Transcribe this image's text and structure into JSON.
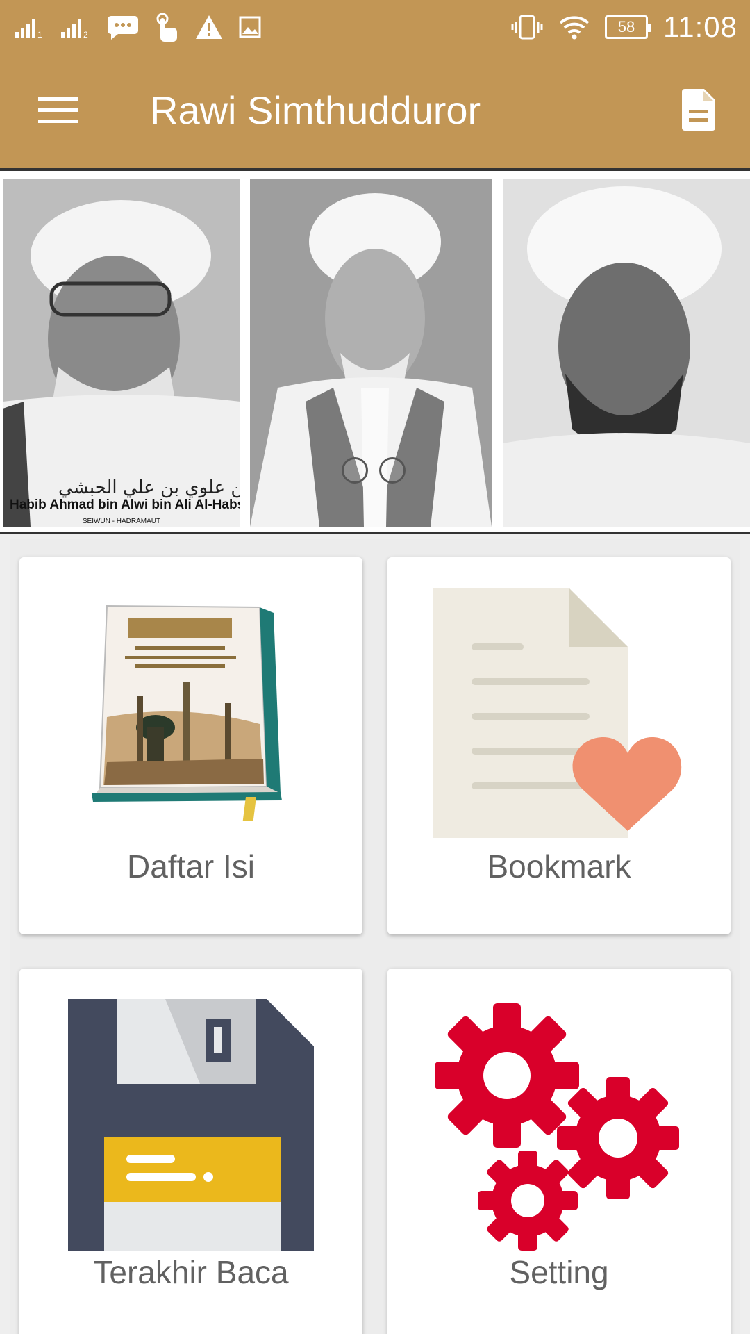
{
  "status_bar": {
    "time": "11:08",
    "battery": "58",
    "icons": [
      "signal-sim1-icon",
      "signal-sim2-icon",
      "message-icon",
      "touch-icon",
      "warning-icon",
      "image-icon",
      "vibrate-icon",
      "wifi-icon",
      "battery-icon"
    ]
  },
  "app_bar": {
    "title": "Rawi Simthudduror",
    "left_icon": "hamburger-menu-icon",
    "right_icon": "document-icon"
  },
  "banner": {
    "photo1_caption": "Habib Ahmad bin Alwi bin Ali Al-Habsyi",
    "photo1_subcaption": "SEIWUN - HADRAMAUT",
    "photo1_arabic": "الحبيب احمد بن علوي بن علي الحبشي",
    "indicator_count": 2
  },
  "menu": {
    "items": [
      {
        "label": "Daftar Isi",
        "icon": "book-icon"
      },
      {
        "label": "Bookmark",
        "icon": "bookmark-document-heart-icon"
      },
      {
        "label": "Terakhir Baca",
        "icon": "floppy-disk-icon"
      },
      {
        "label": "Setting",
        "icon": "gears-icon"
      }
    ]
  },
  "colors": {
    "primary": "#c29655",
    "gear_red": "#d9002a",
    "heart": "#f09070",
    "floppy": "#434a5e",
    "floppy_label": "#ebb81c"
  }
}
